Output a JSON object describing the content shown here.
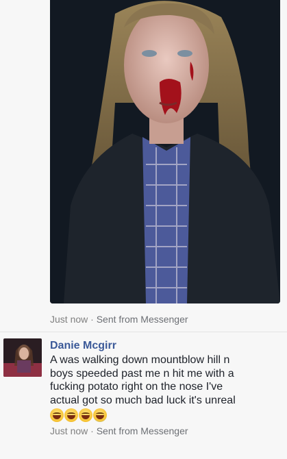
{
  "photo_message": {
    "timestamp": "Just now",
    "separator": " · ",
    "via": "Sent from Messenger"
  },
  "comment": {
    "author": "Danie Mcgirr",
    "text": "A was walking down mountblow hill n\nboys speeded past me n hit me with a\nfucking potato right on the nose I've\nactual got so much bad luck it's unreal",
    "emojis": [
      "joy-emoji",
      "joy-emoji",
      "joy-emoji",
      "sob-emoji"
    ],
    "timestamp": "Just now",
    "separator": " · ",
    "via": "Sent from Messenger"
  },
  "colors": {
    "author_link": "#3b5998",
    "meta_text": "#7f7f7f",
    "background": "#f7f7f7"
  }
}
